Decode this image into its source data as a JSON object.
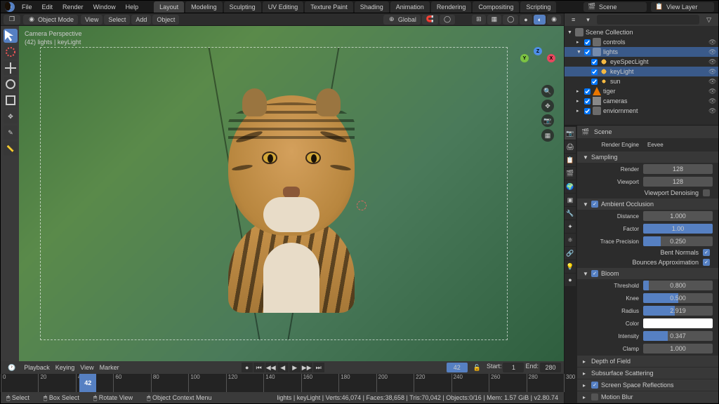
{
  "menus": [
    "File",
    "Edit",
    "Render",
    "Window",
    "Help"
  ],
  "workspaces": [
    "Layout",
    "Modeling",
    "Sculpting",
    "UV Editing",
    "Texture Paint",
    "Shading",
    "Animation",
    "Rendering",
    "Compositing",
    "Scripting"
  ],
  "active_workspace": "Layout",
  "scene_name": "Scene",
  "view_layer_name": "View Layer",
  "viewport": {
    "mode": "Object Mode",
    "header_menus": [
      "View",
      "Select",
      "Add",
      "Object"
    ],
    "orientation": "Global",
    "camera_label": "Camera Perspective",
    "selection": "(42) lights | keyLight"
  },
  "outliner": {
    "root": "Scene Collection",
    "items": [
      {
        "name": "controls",
        "kind": "coll",
        "depth": 1,
        "expanded": false
      },
      {
        "name": "lights",
        "kind": "coll",
        "depth": 1,
        "expanded": true,
        "selected": true
      },
      {
        "name": "eyeSpecLight",
        "kind": "light",
        "depth": 2
      },
      {
        "name": "keyLight",
        "kind": "light",
        "depth": 2,
        "selected": true
      },
      {
        "name": "sun",
        "kind": "sun",
        "depth": 2
      },
      {
        "name": "tiger",
        "kind": "mesh",
        "depth": 1,
        "expanded": false
      },
      {
        "name": "cameras",
        "kind": "cam",
        "depth": 1,
        "expanded": false
      },
      {
        "name": "enviornment",
        "kind": "coll",
        "depth": 1,
        "expanded": false
      }
    ]
  },
  "properties": {
    "scene_label": "Scene",
    "engine_label": "Render Engine",
    "engine": "Eevee",
    "sampling": {
      "title": "Sampling",
      "render_label": "Render",
      "render": "128",
      "viewport_label": "Viewport",
      "viewport": "128",
      "denoise_label": "Viewport Denoising"
    },
    "ao": {
      "title": "Ambient Occlusion",
      "enabled": true,
      "distance_label": "Distance",
      "distance": "1.000",
      "factor_label": "Factor",
      "factor": "1.00",
      "trace_label": "Trace Precision",
      "trace": "0.250",
      "bent_label": "Bent Normals",
      "bent": true,
      "bounce_label": "Bounces Approximation",
      "bounce": true
    },
    "bloom": {
      "title": "Bloom",
      "enabled": true,
      "threshold_label": "Threshold",
      "threshold": "0.800",
      "knee_label": "Knee",
      "knee": "0.500",
      "radius_label": "Radius",
      "radius": "2.919",
      "color_label": "Color",
      "intensity_label": "Intensity",
      "intensity": "0.347",
      "clamp_label": "Clamp",
      "clamp": "1.000"
    },
    "panels": [
      {
        "label": "Depth of Field"
      },
      {
        "label": "Subsurface Scattering"
      },
      {
        "label": "Screen Space Reflections",
        "check": true
      },
      {
        "label": "Motion Blur",
        "check": false
      }
    ]
  },
  "timeline": {
    "menus": [
      "Playback",
      "Keying",
      "View",
      "Marker"
    ],
    "current": "42",
    "start_label": "Start:",
    "start": "1",
    "end_label": "End:",
    "end": "280",
    "ticks": [
      0,
      20,
      40,
      60,
      80,
      100,
      120,
      140,
      160,
      180,
      200,
      220,
      240,
      260,
      280,
      300
    ]
  },
  "status": {
    "left": [
      "Select",
      "Box Select",
      "Rotate View",
      "Object Context Menu"
    ],
    "right": "lights | keyLight | Verts:46,074 | Faces:38,658 | Tris:70,042 | Objects:0/16 | Mem: 1.57 GiB | v2.80.74"
  }
}
